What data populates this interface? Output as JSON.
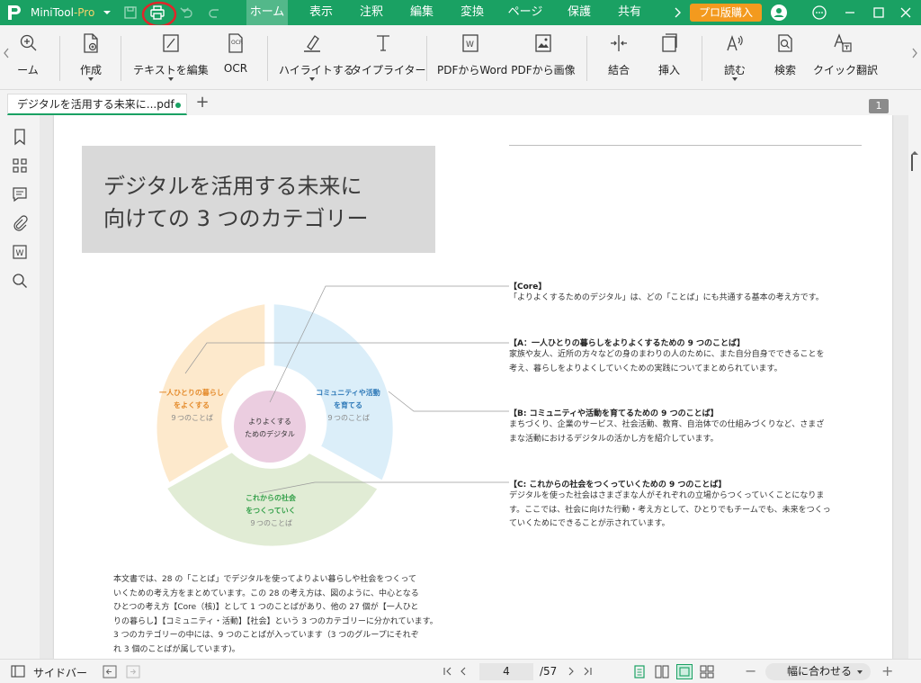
{
  "app": {
    "name": "MiniTool",
    "edition": "-Pro"
  },
  "menu": [
    "ホーム",
    "表示",
    "注釈",
    "編集",
    "変換",
    "ページ",
    "保護",
    "共有"
  ],
  "buy_label": "プロ版購入",
  "ribbon": {
    "zoom_partial": "ーム",
    "create": "作成",
    "edit_text": "テキストを編集",
    "ocr": "OCR",
    "highlight": "ハイライトする",
    "typewriter": "タイプライター",
    "pdf_to_word": "PDFからWord",
    "pdf_to_image": "PDFから画像",
    "merge": "結合",
    "insert": "挿入",
    "read": "読む",
    "search": "検索",
    "quick_translate": "クイック翻訳"
  },
  "tab": {
    "filename": "デジタルを活用する未来に...pdf"
  },
  "page_badge": "1",
  "document": {
    "title_line1": "デジタルを活用する未来に",
    "title_line2": "向けての 3 つのカテゴリー",
    "diagram": {
      "center": [
        "よりよくする",
        "ためのデジタル"
      ],
      "a_label": [
        "一人ひとりの暮らし",
        "をよくする"
      ],
      "a_sub": "９つのことば",
      "b_label": [
        "コミュニティや活動",
        "を育てる"
      ],
      "b_sub": "９つのことば",
      "c_label": [
        "これからの社会",
        "をつくっていく"
      ],
      "c_sub": "９つのことば",
      "colors": {
        "a": "#fde9cc",
        "b": "#dbeef9",
        "c": "#e1ecd5",
        "center": "#ebcde0",
        "a_text": "#e48a2a",
        "b_text": "#2e79b8",
        "c_text": "#34a04a"
      }
    },
    "categories": [
      {
        "head": "【Core】",
        "body": [
          "「よりよくするためのデジタル」は、どの「ことば」にも共通する基本の考え方です。"
        ]
      },
      {
        "head": "【A：一人ひとりの暮らしをよりよくするための 9 つのことば】",
        "body": [
          "家族や友人、近所の方々などの身のまわりの人のために、また自分自身でできることを",
          "考え、暮らしをよりよくしていくための実践についてまとめられています。"
        ]
      },
      {
        "head": "【B: コミュニティや活動を育てるための 9 つのことば】",
        "body": [
          "まちづくり、企業のサービス、社会活動、教育、自治体での仕組みづくりなど、さまざ",
          "まな活動におけるデジタルの活かし方を紹介しています。"
        ]
      },
      {
        "head": "【C: これからの社会をつくっていくための 9 つのことば】",
        "body": [
          "デジタルを使った社会はさまざまな人がそれぞれの立場からつくっていくことになりま",
          "す。ここでは、社会に向けた行動・考え方として、ひとりでもチームでも、未来をつくっ",
          "ていくためにできることが示されています。"
        ]
      }
    ],
    "bottom_text": [
      "本文書では、28 の「ことば」でデジタルを使ってよりよい暮らしや社会をつくって",
      "いくための考え方をまとめています。この 28 の考え方は、図のように、中心となる",
      "ひとつの考え方【Core（核)】として 1 つのことばがあり、他の 27 個が【一人ひと",
      "りの暮らし】【コミュニティ・活動】【社会】という 3 つのカテゴリーに分かれています。",
      "3 つのカテゴリーの中には、9 つのことばが入っています（3 つのグループにそれぞ",
      "れ 3 個のことばが属しています)。"
    ]
  },
  "status": {
    "sidebar_label": "サイドバー",
    "page_current": "4",
    "page_total": "/57",
    "zoom": "幅に合わせる"
  },
  "accent": "#1aa163"
}
